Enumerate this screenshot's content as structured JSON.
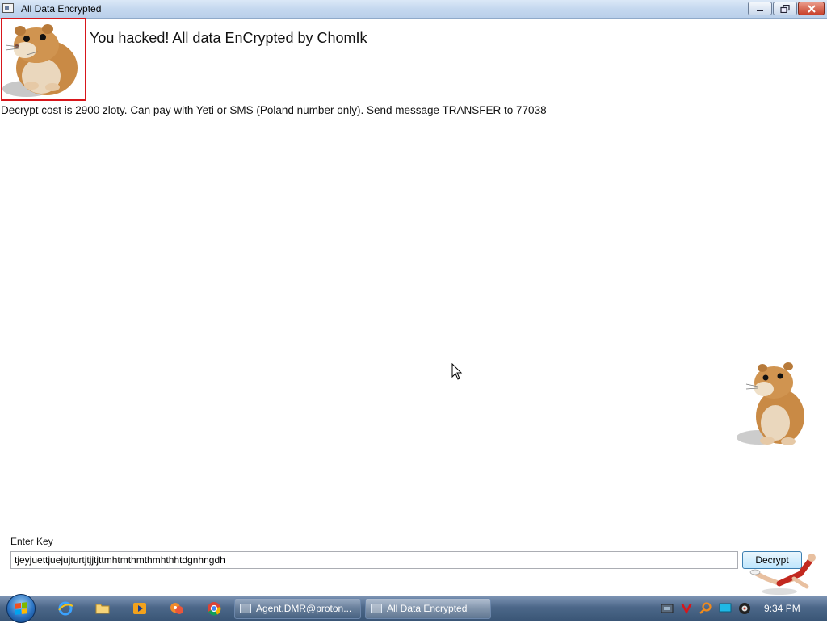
{
  "window": {
    "title": "All Data Encrypted",
    "controls": {
      "minimize": "–",
      "maximize": "❐",
      "close": "✕"
    }
  },
  "content": {
    "headline": "You hacked! All data EnCrypted by ChomIk",
    "cost_message": "Decrypt cost is 2900 zloty. Can pay with Yeti or SMS (Poland number only). Send message TRANSFER to 77038",
    "key_label": "Enter Key",
    "key_value": "tjeyjuettjuejujturtjtjjtjttmhtmthmthmhthhtdgnhngdh",
    "decrypt_button": "Decrypt"
  },
  "taskbar": {
    "pinned": [
      "internet-explorer-icon",
      "explorer-folder-icon",
      "media-player-icon",
      "paint-app-icon",
      "chrome-icon"
    ],
    "tasks": [
      {
        "label": "Agent.DMR@proton...",
        "active": false
      },
      {
        "label": "All Data Encrypted",
        "active": true
      }
    ],
    "tray": [
      "network-icon",
      "antivirus-icon",
      "search-tray-icon",
      "display-icon",
      "volume-icon"
    ],
    "clock": "9:34 PM"
  },
  "colors": {
    "frame_border": "#d8161b",
    "titlebar": "#c5d8ef",
    "taskbar": "#4c6789"
  }
}
